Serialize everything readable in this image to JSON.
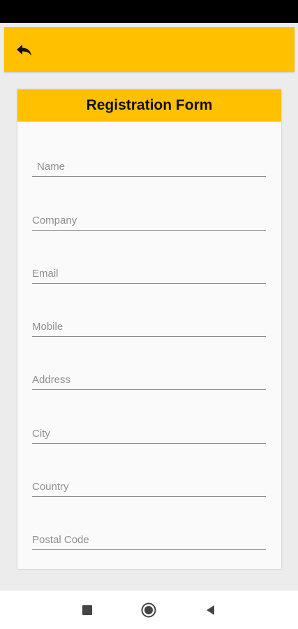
{
  "app_bar": {
    "back_icon": "back-arrow-icon",
    "color": "#ffc000"
  },
  "form": {
    "title": "Registration Form",
    "fields": [
      {
        "placeholder": "Name",
        "value": ""
      },
      {
        "placeholder": "Company",
        "value": ""
      },
      {
        "placeholder": "Email",
        "value": ""
      },
      {
        "placeholder": "Mobile",
        "value": ""
      },
      {
        "placeholder": "Address",
        "value": ""
      },
      {
        "placeholder": "City",
        "value": ""
      },
      {
        "placeholder": "Country",
        "value": ""
      },
      {
        "placeholder": "Postal Code",
        "value": ""
      }
    ]
  },
  "nav": {
    "recents_icon": "square-icon",
    "home_icon": "circle-home-icon",
    "back_icon": "triangle-back-icon"
  }
}
